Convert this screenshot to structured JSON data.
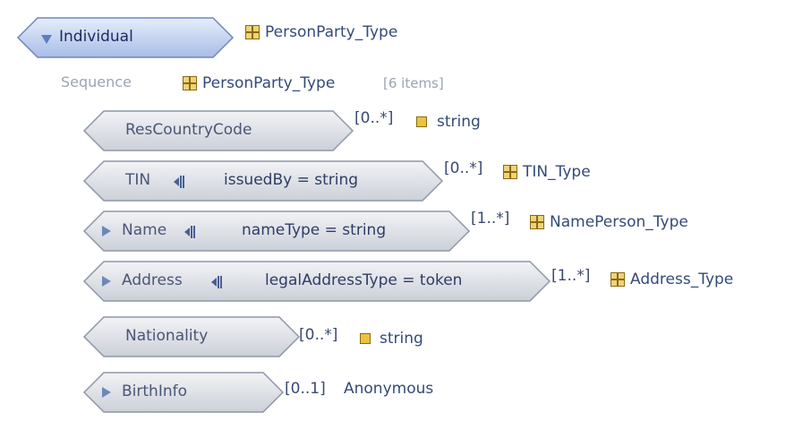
{
  "root": {
    "label": "Individual",
    "type": "PersonParty_Type",
    "icon": "complex-type-icon"
  },
  "sequence": {
    "label": "Sequence",
    "type": "PersonParty_Type",
    "count": "[6 items]"
  },
  "elements": [
    {
      "name": "ResCountryCode",
      "attribute": "",
      "card": "[0..*]",
      "type": "string",
      "type_icon": "simple-type-icon",
      "expandable": false
    },
    {
      "name": "TIN",
      "attribute": "issuedBy = string",
      "card": "[0..*]",
      "type": "TIN_Type",
      "type_icon": "complex-type-icon",
      "expandable": false
    },
    {
      "name": "Name",
      "attribute": "nameType = string",
      "card": "[1..*]",
      "type": "NamePerson_Type",
      "type_icon": "complex-type-icon",
      "expandable": true
    },
    {
      "name": "Address",
      "attribute": "legalAddressType = token",
      "card": "[1..*]",
      "type": "Address_Type",
      "type_icon": "complex-type-icon",
      "expandable": true
    },
    {
      "name": "Nationality",
      "attribute": "",
      "card": "[0..*]",
      "type": "string",
      "type_icon": "simple-type-icon",
      "expandable": false
    },
    {
      "name": "BirthInfo",
      "attribute": "",
      "card": "[0..1]",
      "type": "Anonymous",
      "type_icon": "",
      "expandable": true
    }
  ],
  "colors": {
    "hex_fill_top": "#eef0f4",
    "hex_fill_bottom": "#cfd4dc",
    "hex_stroke": "#8d97a8",
    "root_fill_top": "#e4ecfa",
    "root_fill_bottom": "#a9bde6",
    "root_stroke": "#6f86b8"
  }
}
